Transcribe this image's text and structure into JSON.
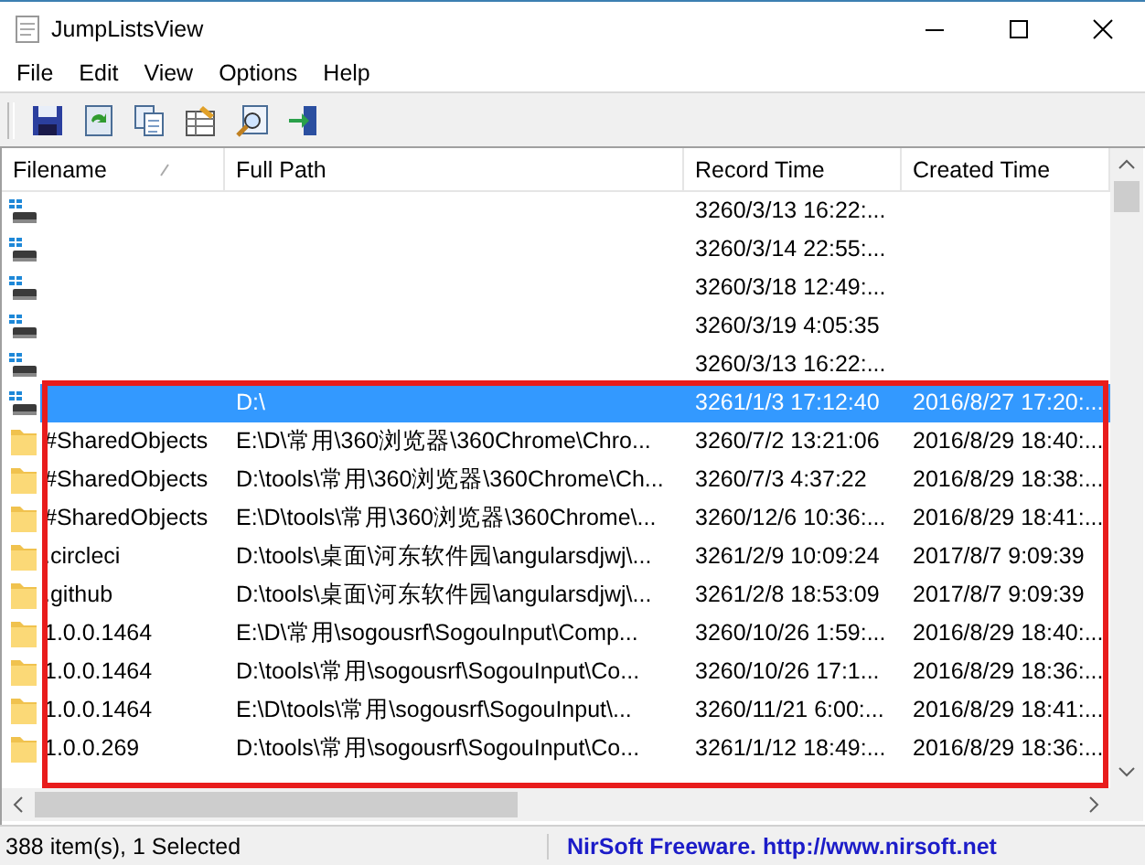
{
  "window": {
    "title": "JumpListsView"
  },
  "menu": [
    "File",
    "Edit",
    "View",
    "Options",
    "Help"
  ],
  "toolbar": [
    {
      "kind": "save"
    },
    {
      "kind": "refresh"
    },
    {
      "kind": "copy"
    },
    {
      "kind": "properties"
    },
    {
      "kind": "find"
    },
    {
      "kind": "exit"
    }
  ],
  "table": {
    "columns": [
      {
        "label": "Filename",
        "sorted": true
      },
      {
        "label": "Full Path",
        "sorted": false
      },
      {
        "label": "Record Time",
        "sorted": false
      },
      {
        "label": "Created Time",
        "sorted": false
      }
    ],
    "rows": [
      {
        "kind": "drive",
        "selected": false,
        "cells": [
          "",
          "",
          "3260/3/13 16:22:...",
          ""
        ]
      },
      {
        "kind": "drive",
        "selected": false,
        "cells": [
          "",
          "",
          "3260/3/14 22:55:...",
          ""
        ]
      },
      {
        "kind": "drive",
        "selected": false,
        "cells": [
          "",
          "",
          "3260/3/18 12:49:...",
          ""
        ]
      },
      {
        "kind": "drive",
        "selected": false,
        "cells": [
          "",
          "",
          "3260/3/19 4:05:35",
          ""
        ]
      },
      {
        "kind": "drive",
        "selected": false,
        "cells": [
          "",
          "",
          "3260/3/13 16:22:...",
          ""
        ]
      },
      {
        "kind": "drive",
        "selected": true,
        "cells": [
          "",
          "D:\\",
          "3261/1/3 17:12:40",
          "2016/8/27 17:20:..."
        ]
      },
      {
        "kind": "folder",
        "selected": false,
        "cells": [
          "#SharedObjects",
          "E:\\D\\常用\\360浏览器\\360Chrome\\Chro...",
          "3260/7/2 13:21:06",
          "2016/8/29 18:40:..."
        ]
      },
      {
        "kind": "folder",
        "selected": false,
        "cells": [
          "#SharedObjects",
          "D:\\tools\\常用\\360浏览器\\360Chrome\\Ch...",
          "3260/7/3 4:37:22",
          "2016/8/29 18:38:..."
        ]
      },
      {
        "kind": "folder",
        "selected": false,
        "cells": [
          "#SharedObjects",
          "E:\\D\\tools\\常用\\360浏览器\\360Chrome\\...",
          "3260/12/6 10:36:...",
          "2016/8/29 18:41:..."
        ]
      },
      {
        "kind": "folder",
        "selected": false,
        "cells": [
          ".circleci",
          "D:\\tools\\桌面\\河东软件园\\angularsdjwj\\...",
          "3261/2/9 10:09:24",
          "2017/8/7 9:09:39"
        ]
      },
      {
        "kind": "folder",
        "selected": false,
        "cells": [
          ".github",
          "D:\\tools\\桌面\\河东软件园\\angularsdjwj\\...",
          "3261/2/8 18:53:09",
          "2017/8/7 9:09:39"
        ]
      },
      {
        "kind": "folder",
        "selected": false,
        "cells": [
          "1.0.0.1464",
          "E:\\D\\常用\\sogousrf\\SogouInput\\Comp...",
          "3260/10/26 1:59:...",
          "2016/8/29 18:40:..."
        ]
      },
      {
        "kind": "folder",
        "selected": false,
        "cells": [
          "1.0.0.1464",
          "D:\\tools\\常用\\sogousrf\\SogouInput\\Co...",
          "3260/10/26 17:1...",
          "2016/8/29 18:36:..."
        ]
      },
      {
        "kind": "folder",
        "selected": false,
        "cells": [
          "1.0.0.1464",
          "E:\\D\\tools\\常用\\sogousrf\\SogouInput\\...",
          "3260/11/21 6:00:...",
          "2016/8/29 18:41:..."
        ]
      },
      {
        "kind": "folder",
        "selected": false,
        "cells": [
          "1.0.0.269",
          "D:\\tools\\常用\\sogousrf\\SogouInput\\Co...",
          "3261/1/12 18:49:...",
          "2016/8/29 18:36:..."
        ]
      }
    ]
  },
  "highlight_frame": true,
  "status_bar": {
    "count": "388 item(s), 1 Selected",
    "credit": "NirSoft Freeware.  http://www.nirsoft.net"
  }
}
